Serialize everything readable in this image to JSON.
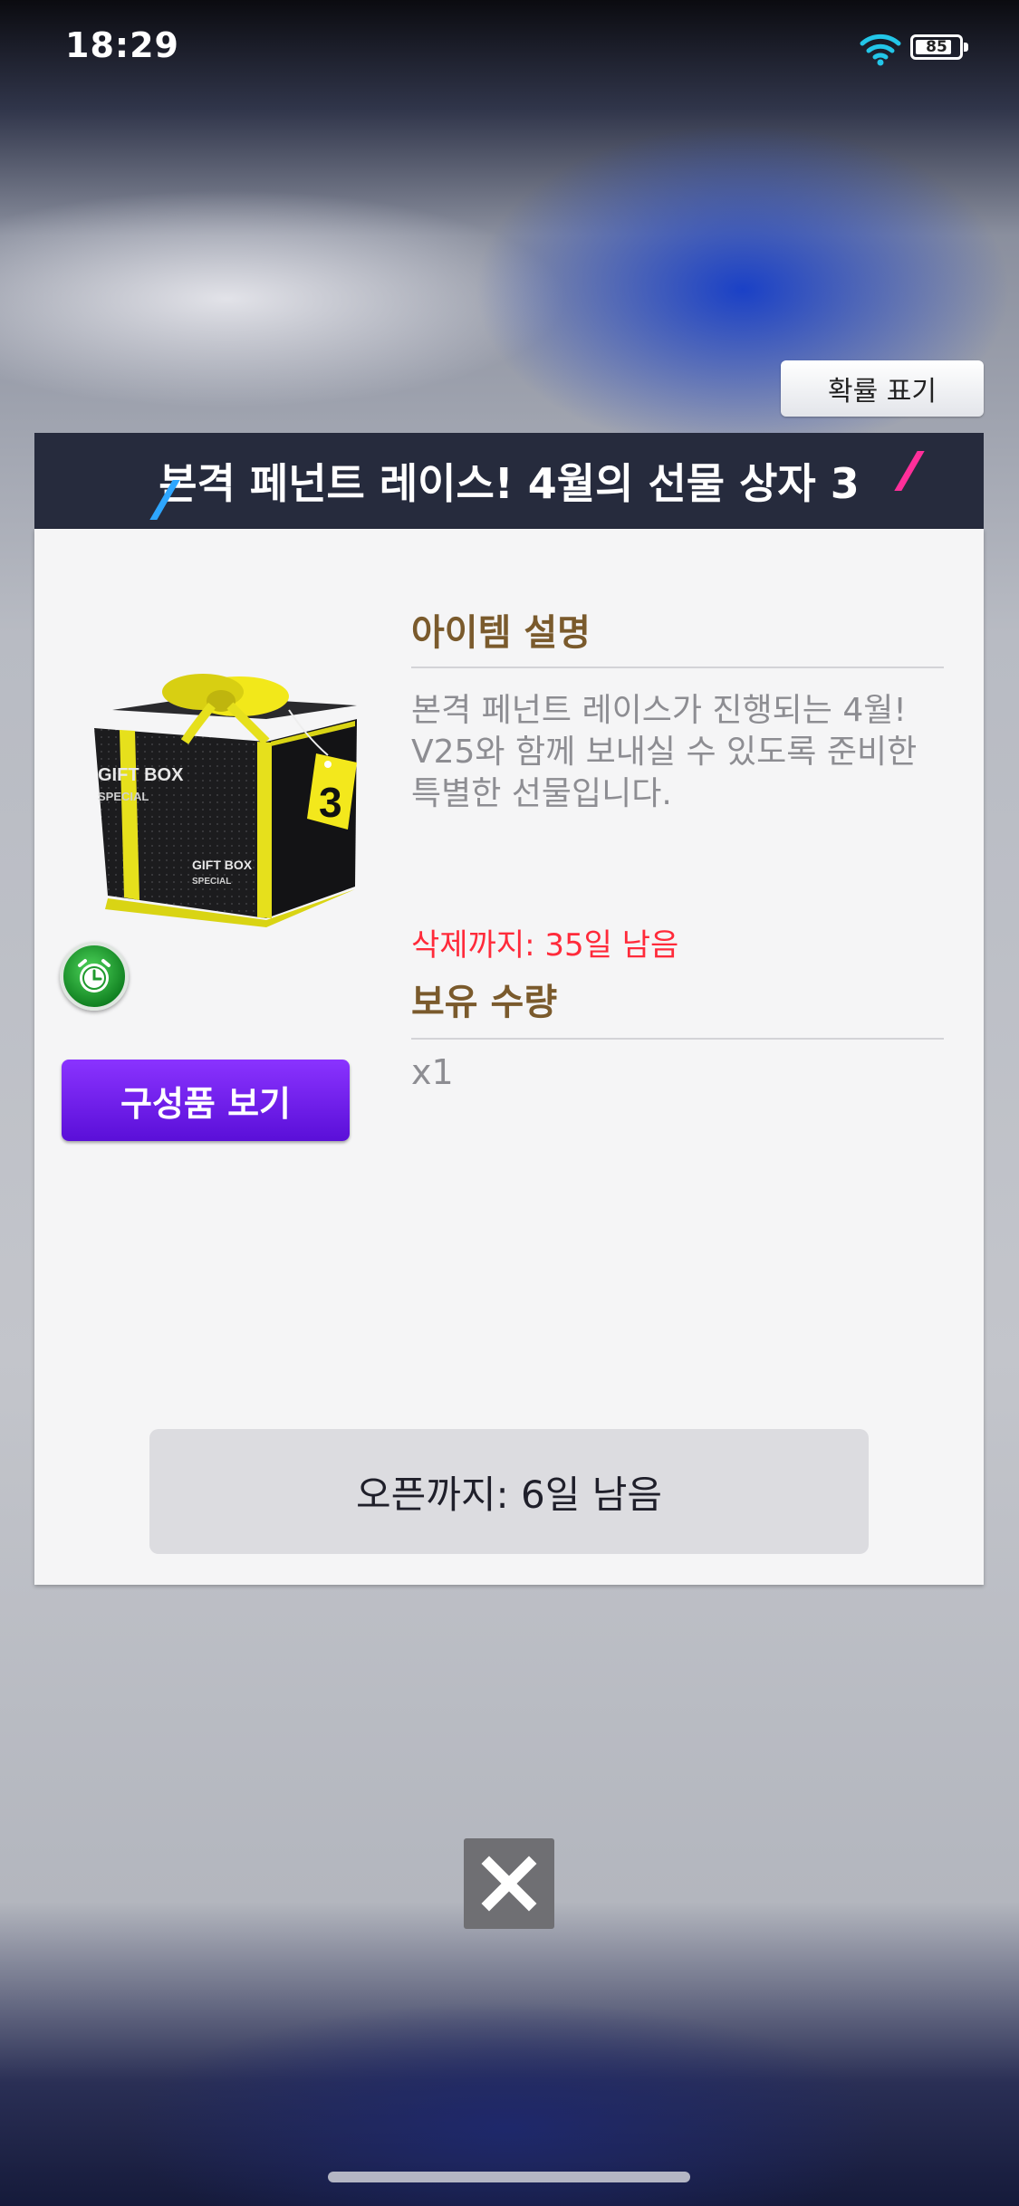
{
  "status_bar": {
    "time": "18:29",
    "battery": "85",
    "battery_level": 0.85
  },
  "popup": {
    "probability_button": "확률 표기",
    "title": "본격 페넌트 레이스! 4월의 선물 상자 3",
    "item": {
      "box_label": "GIFT BOX",
      "box_sublabel": "SPECIAL",
      "box_side_label": "GIFT BOX",
      "box_side_sublabel": "SPECIAL",
      "tag_number": "3",
      "components_button": "구성품 보기"
    },
    "description_header": "아이템 설명",
    "description_lines": [
      "본격 페넌트 레이스가 진행되는 4월!",
      "V25와 함께 보내실 수 있도록 준비한",
      "특별한 선물입니다."
    ],
    "delete_note": "삭제까지: 35일 남음",
    "quantity_header": "보유 수량",
    "quantity": "x1",
    "open_status": "오픈까지: 6일 남음"
  },
  "icons": [
    "wifi-icon",
    "battery-icon",
    "alarm-clock-icon",
    "close-icon"
  ],
  "colors": {
    "header_bg": "#262b3d",
    "accent_purple": "#6a1fe8",
    "delete_red": "#ff2a3a",
    "section_brown": "#7a5a2c"
  }
}
